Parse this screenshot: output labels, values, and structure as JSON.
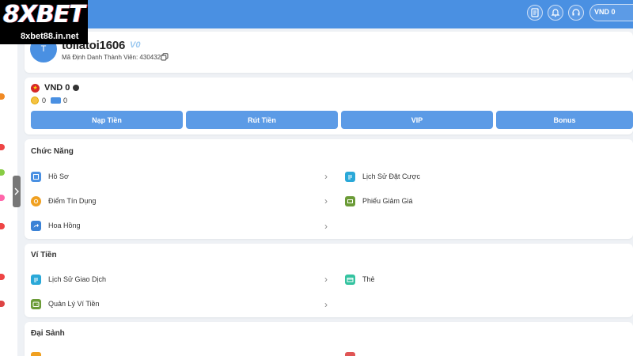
{
  "logo": {
    "brand": "8XBET",
    "url": "8xbet88.in.net"
  },
  "header": {
    "balance_label": "VND 0"
  },
  "profile": {
    "avatar_initial": "T",
    "username": "tollatoi1606",
    "vip_badge": "V0",
    "uid_text": "Mã Định Danh Thành Viên: 4304322"
  },
  "wallet": {
    "balance": "VND 0",
    "coins": "0",
    "tickets": "0"
  },
  "actions": [
    {
      "label": "Nạp Tiền"
    },
    {
      "label": "Rút Tiền"
    },
    {
      "label": "VIP"
    },
    {
      "label": "Bonus"
    }
  ],
  "sections": {
    "chuc_nang": {
      "title": "Chức Năng",
      "items": [
        {
          "label": "Hồ Sơ",
          "color": "#4a90e2"
        },
        {
          "label": "Lịch Sử Đặt Cược",
          "color": "#2aa8d8"
        },
        {
          "label": "Điểm Tín Dụng",
          "color": "#f0a020"
        },
        {
          "label": "Phiếu Giảm Giá",
          "color": "#6b9b37"
        },
        {
          "label": "Hoa Hồng",
          "color": "#3b82d6"
        }
      ]
    },
    "vi_tien": {
      "title": "Ví Tiền",
      "items": [
        {
          "label": "Lịch Sử Giao Dịch",
          "color": "#2aa8d8"
        },
        {
          "label": "Thẻ",
          "color": "#34c3a0"
        },
        {
          "label": "Quản Lý Ví Tiền",
          "color": "#6b9b37"
        }
      ]
    },
    "dai_sanh": {
      "title": "Đại Sảnh"
    }
  }
}
